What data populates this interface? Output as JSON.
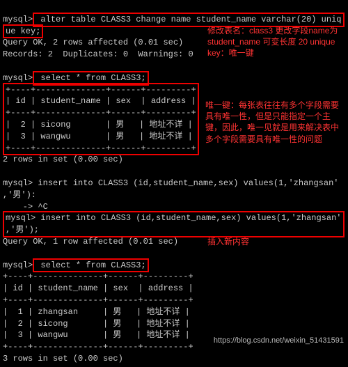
{
  "lines": {
    "l1_prompt": "mysql>",
    "l1_cmd": " alter table CLASS3 change name student_name varchar(20) uniq",
    "l2_cmd": "ue key;",
    "l3": "Query OK, 2 rows affected (0.01 sec)",
    "l4": "Records: 2  Duplicates: 0  Warnings: 0",
    "blank1": "",
    "l5_prompt": "mysql>",
    "l5_cmd": " select * from CLASS3;",
    "sep1": "+----+--------------+------+---------+",
    "hdr1": "| id | student_name | sex  | address |",
    "sep2": "+----+--------------+------+---------+",
    "row1": "|  2 | sicong       | 男   | 地址不详 |",
    "row2": "|  3 | wangwu       | 男   | 地址不详 |",
    "sep3": "+----+--------------+------+---------+",
    "l6": "2 rows in set (0.00 sec)",
    "blank2": "",
    "l7_prompt": "mysql>",
    "l7_cmd": " insert into CLASS3 (id,student_name,sex) values(1,'zhangsan'",
    "l8": ",'男'):",
    "l9": "    -> ^C",
    "l10_prompt": "mysql>",
    "l10_cmd": " insert into CLASS3 (id,student_name,sex) values(1,'zhangsan'",
    "l11": ",'男');",
    "l12": "Query OK, 1 row affected (0.01 sec)",
    "blank3": "",
    "l13_prompt": "mysql>",
    "l13_cmd": " select * from CLASS3;",
    "sep4": "+----+--------------+------+---------+",
    "hdr2": "| id | student_name | sex  | address |",
    "sep5": "+----+--------------+------+---------+",
    "row3": "|  1 | zhangsan     | 男   | 地址不详 |",
    "row4": "|  2 | sicong       | 男   | 地址不详 |",
    "row5": "|  3 | wangwu       | 男   | 地址不详 |",
    "sep6": "+----+--------------+------+---------+",
    "l14": "3 rows in set (0.00 sec)"
  },
  "annotations": {
    "a1": "修改表名：class3 更改字段name为student_name 可变长度 20 unique key：唯一键",
    "a2": "唯一键：每张表往往有多个字段需要具有唯一性，但是只能指定一个主键，因此，唯一见就是用来解决表中多个字段需要具有唯一性的问题",
    "a3": "插入新内容"
  },
  "watermark": "https://blog.csdn.net/weixin_51431591"
}
